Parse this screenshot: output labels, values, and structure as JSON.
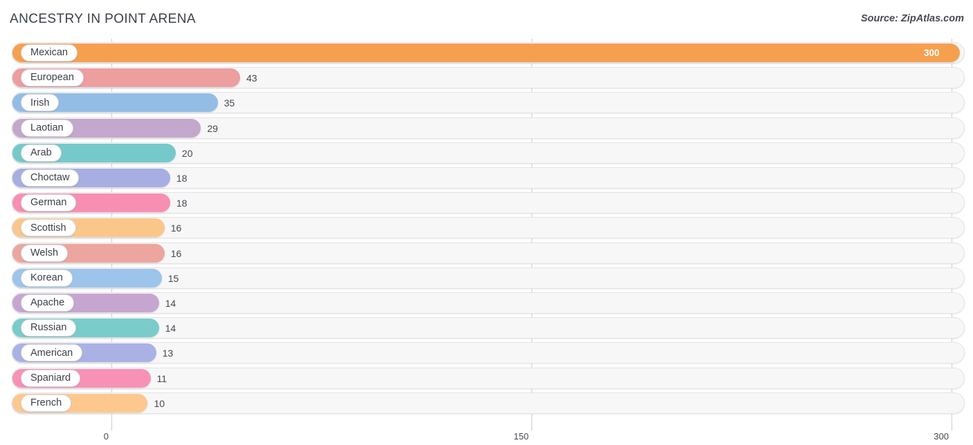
{
  "header": {
    "title": "ANCESTRY IN POINT ARENA",
    "source": "Source: ZipAtlas.com"
  },
  "axis": {
    "ticks": [
      "0",
      "150",
      "300"
    ]
  },
  "chart_data": {
    "type": "bar",
    "orientation": "horizontal",
    "title": "ANCESTRY IN POINT ARENA",
    "subtitle": "Source: ZipAtlas.com",
    "xlabel": "",
    "ylabel": "",
    "xlim": [
      0,
      300
    ],
    "xticks": [
      0,
      150,
      300
    ],
    "grid": true,
    "legend": false,
    "categories": [
      "Mexican",
      "European",
      "Irish",
      "Laotian",
      "Arab",
      "Choctaw",
      "German",
      "Scottish",
      "Welsh",
      "Korean",
      "Apache",
      "Russian",
      "American",
      "Spaniard",
      "French"
    ],
    "values": [
      300,
      43,
      35,
      29,
      20,
      18,
      18,
      16,
      16,
      15,
      14,
      14,
      13,
      11,
      10
    ],
    "bars": [
      {
        "label": "Mexican",
        "value": 300,
        "value_text": "300",
        "color": "#f5a04e",
        "inside": true
      },
      {
        "label": "European",
        "value": 43,
        "value_text": "43",
        "color": "#ed9e9e",
        "inside": false
      },
      {
        "label": "Irish",
        "value": 35,
        "value_text": "35",
        "color": "#93bde5",
        "inside": false
      },
      {
        "label": "Laotian",
        "value": 29,
        "value_text": "29",
        "color": "#c3a7cd",
        "inside": false
      },
      {
        "label": "Arab",
        "value": 20,
        "value_text": "20",
        "color": "#76c9ca",
        "inside": false
      },
      {
        "label": "Choctaw",
        "value": 18,
        "value_text": "18",
        "color": "#a7aee2",
        "inside": false
      },
      {
        "label": "German",
        "value": 18,
        "value_text": "18",
        "color": "#f78fb3",
        "inside": false
      },
      {
        "label": "Scottish",
        "value": 16,
        "value_text": "16",
        "color": "#fbc68a",
        "inside": false
      },
      {
        "label": "Welsh",
        "value": 16,
        "value_text": "16",
        "color": "#eda59f",
        "inside": false
      },
      {
        "label": "Korean",
        "value": 15,
        "value_text": "15",
        "color": "#9dc4ea",
        "inside": false
      },
      {
        "label": "Apache",
        "value": 14,
        "value_text": "14",
        "color": "#c6a6d1",
        "inside": false
      },
      {
        "label": "Russian",
        "value": 14,
        "value_text": "14",
        "color": "#79ccca",
        "inside": false
      },
      {
        "label": "American",
        "value": 13,
        "value_text": "13",
        "color": "#aab1e4",
        "inside": false
      },
      {
        "label": "Spaniard",
        "value": 11,
        "value_text": "11",
        "color": "#f891b6",
        "inside": false
      },
      {
        "label": "French",
        "value": 10,
        "value_text": "10",
        "color": "#fcc88e",
        "inside": false
      }
    ]
  }
}
